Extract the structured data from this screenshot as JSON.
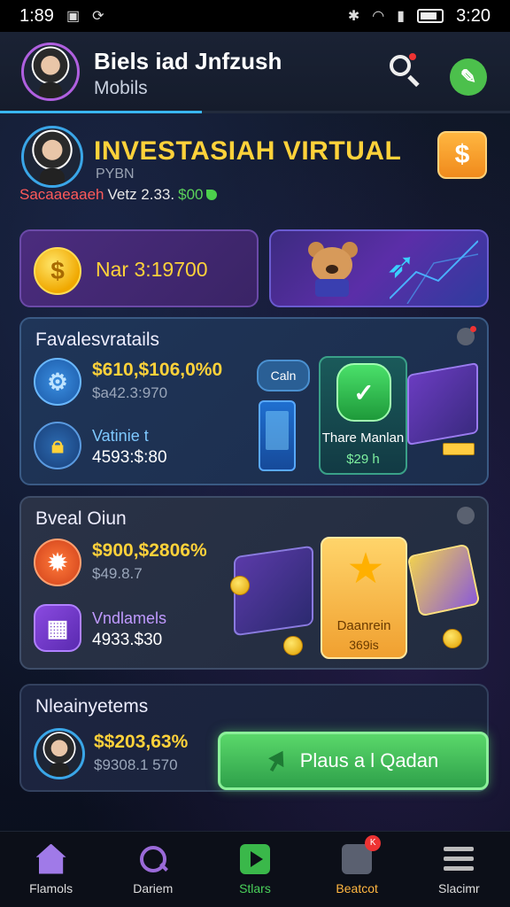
{
  "status_bar": {
    "time": "1:89",
    "right_time": "3:20"
  },
  "header": {
    "title": "Biels iad Jnfzush",
    "subtitle": "Mobils"
  },
  "profile": {
    "title": "INVESTASIAH VIRTUAL",
    "subtitle": "PYBN",
    "info_red": "Sacaaeaaeh",
    "info_white": "Vetz 2.33.",
    "info_green": "$00"
  },
  "balance": {
    "value": "Nar 3:19700"
  },
  "section1": {
    "title": "Favalesvratails",
    "stat1_value": "$610,$106,0%0",
    "stat1_sub": "$a42.3:970",
    "stat2_label": "Vatinie t",
    "stat2_value": "4593:$:80",
    "chat_label": "Caln",
    "tile_label": "Thare Manlan",
    "tile_value": "$29 h"
  },
  "section2": {
    "title": "Bveal Oiun",
    "stat1_value": "$900,$2806%",
    "stat1_sub": "$49.8.7",
    "stat2_label": "Vndlamels",
    "stat2_value": "4933.$30",
    "gold_label": "Daanrein",
    "gold_value": "369is"
  },
  "section3": {
    "title": "Nleainyetems",
    "stat_value": "$$203,63%",
    "stat_sub": "$9308.1 570",
    "cta_label": "Plaus a l Qadan"
  },
  "nav": [
    {
      "label": "Flamols",
      "icon": "home-icon"
    },
    {
      "label": "Dariem",
      "icon": "search-icon"
    },
    {
      "label": "Stlars",
      "icon": "play-icon"
    },
    {
      "label": "Beatcot",
      "icon": "chat-icon",
      "badge": "K"
    },
    {
      "label": "Slacimr",
      "icon": "menu-icon"
    }
  ],
  "colors": {
    "accent_yellow": "#ffd23a",
    "accent_green": "#4cc04c",
    "accent_blue": "#39b6f0",
    "accent_purple": "#a07ae8"
  }
}
